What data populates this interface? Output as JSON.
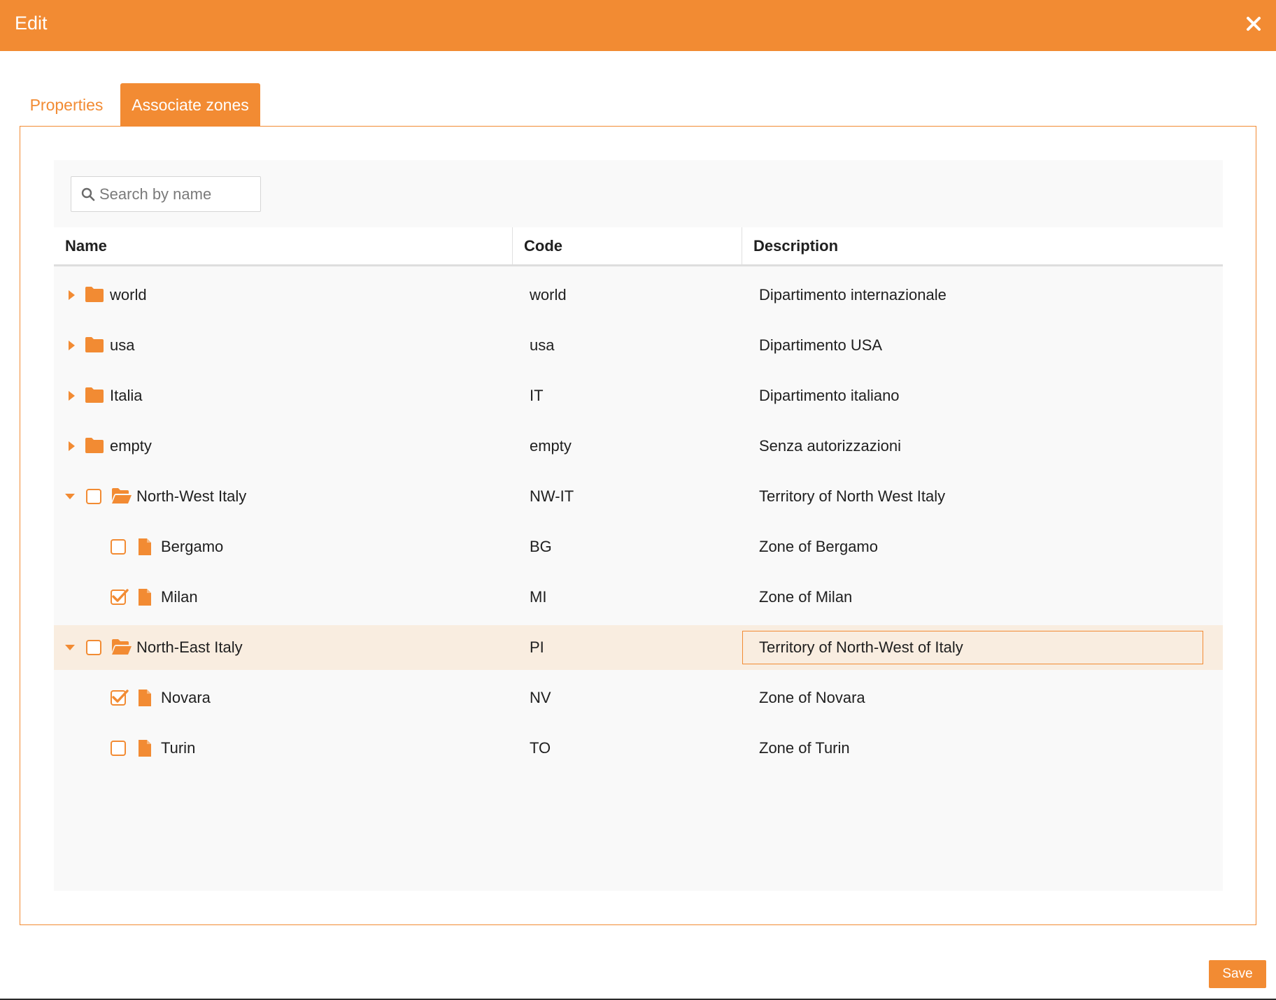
{
  "dialog": {
    "title": "Edit",
    "close_icon": "close-icon"
  },
  "tabs": [
    {
      "label": "Properties",
      "active": false
    },
    {
      "label": "Associate zones",
      "active": true
    }
  ],
  "search": {
    "placeholder": "Search by name",
    "value": ""
  },
  "columns": {
    "name": "Name",
    "code": "Code",
    "description": "Description"
  },
  "rows": [
    {
      "name": "world",
      "code": "world",
      "description": "Dipartimento internazionale",
      "type": "folder",
      "expanded": false,
      "checked": null,
      "level": 0
    },
    {
      "name": "usa",
      "code": "usa",
      "description": "Dipartimento USA",
      "type": "folder",
      "expanded": false,
      "checked": null,
      "level": 0
    },
    {
      "name": "Italia",
      "code": "IT",
      "description": "Dipartimento italiano",
      "type": "folder",
      "expanded": false,
      "checked": null,
      "level": 0
    },
    {
      "name": "empty",
      "code": "empty",
      "description": "Senza autorizzazioni",
      "type": "folder",
      "expanded": false,
      "checked": null,
      "level": 0
    },
    {
      "name": "North-West Italy",
      "code": "NW-IT",
      "description": "Territory of North West Italy",
      "type": "folder-open",
      "expanded": true,
      "checked": false,
      "level": 0
    },
    {
      "name": "Bergamo",
      "code": "BG",
      "description": "Zone of Bergamo",
      "type": "file",
      "checked": false,
      "level": 1
    },
    {
      "name": "Milan",
      "code": "MI",
      "description": "Zone of Milan",
      "type": "file",
      "checked": true,
      "level": 1
    },
    {
      "name": "North-East Italy",
      "code": "PI",
      "description": "Territory of North-West of Italy",
      "type": "folder-open",
      "expanded": true,
      "checked": false,
      "level": 0,
      "selected": true,
      "editing": "description"
    },
    {
      "name": "Novara",
      "code": "NV",
      "description": "Zone of Novara",
      "type": "file",
      "checked": true,
      "level": 1
    },
    {
      "name": "Turin",
      "code": "TO",
      "description": "Zone of Turin",
      "type": "file",
      "checked": false,
      "level": 1
    }
  ],
  "footer": {
    "save_label": "Save"
  },
  "colors": {
    "accent": "#f28b33",
    "selected_row": "#f9ede0",
    "grid_bg": "#f9f9f9"
  }
}
